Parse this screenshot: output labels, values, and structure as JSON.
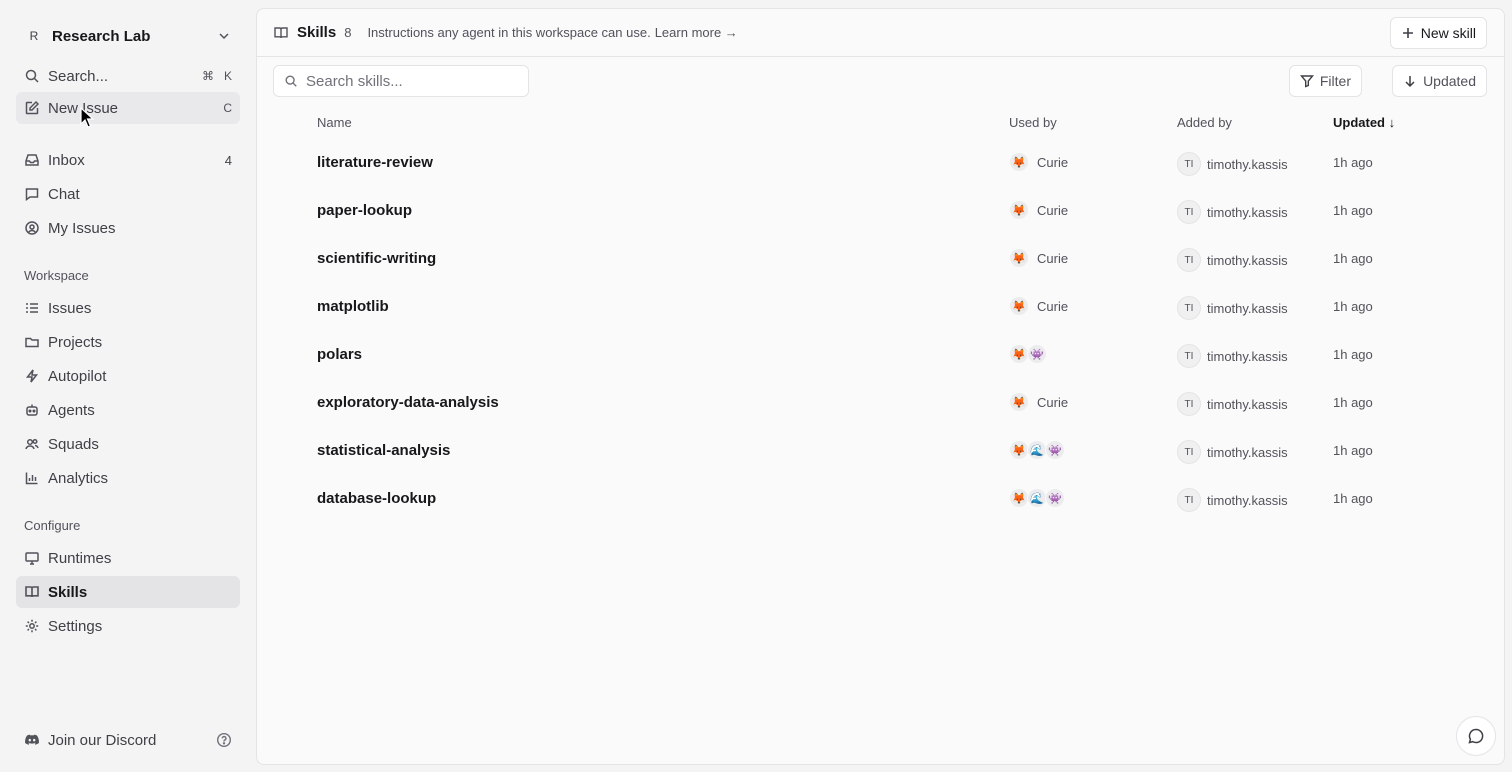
{
  "workspace": {
    "avatar": "R",
    "name": "Research Lab"
  },
  "sidebar": {
    "search": {
      "label": "Search...",
      "shortcut_cmd": "⌘",
      "shortcut_key": "K"
    },
    "new_issue": {
      "label": "New Issue",
      "shortcut": "C"
    },
    "primary": [
      {
        "label": "Inbox",
        "icon": "inbox-icon",
        "count": "4"
      },
      {
        "label": "Chat",
        "icon": "chat-icon"
      },
      {
        "label": "My Issues",
        "icon": "user-circle-icon"
      }
    ],
    "workspace_label": "Workspace",
    "workspace_items": [
      {
        "label": "Issues",
        "icon": "list-icon"
      },
      {
        "label": "Projects",
        "icon": "folder-icon"
      },
      {
        "label": "Autopilot",
        "icon": "bolt-icon"
      },
      {
        "label": "Agents",
        "icon": "bot-icon"
      },
      {
        "label": "Squads",
        "icon": "users-icon"
      },
      {
        "label": "Analytics",
        "icon": "bar-chart-icon"
      }
    ],
    "configure_label": "Configure",
    "configure_items": [
      {
        "label": "Runtimes",
        "icon": "monitor-icon"
      },
      {
        "label": "Skills",
        "icon": "book-icon",
        "active": true
      },
      {
        "label": "Settings",
        "icon": "gear-icon"
      }
    ],
    "footer": {
      "discord_label": "Join our Discord"
    }
  },
  "header": {
    "title": "Skills",
    "count": "8",
    "description": "Instructions any agent in this workspace can use.",
    "learn_more": "Learn more →",
    "new_skill_label": "New skill"
  },
  "toolbar": {
    "search_placeholder": "Search skills...",
    "filter_label": "Filter",
    "sort_label": "Updated"
  },
  "table": {
    "columns": {
      "name": "Name",
      "used_by": "Used by",
      "added_by": "Added by",
      "updated": "Updated ↓"
    },
    "rows": [
      {
        "name": "literature-review",
        "avatars": [
          "🦊"
        ],
        "used_by": "Curie",
        "added_initials": "TI",
        "added_by": "timothy.kassis",
        "updated": "1h ago"
      },
      {
        "name": "paper-lookup",
        "avatars": [
          "🦊"
        ],
        "used_by": "Curie",
        "added_initials": "TI",
        "added_by": "timothy.kassis",
        "updated": "1h ago"
      },
      {
        "name": "scientific-writing",
        "avatars": [
          "🦊"
        ],
        "used_by": "Curie",
        "added_initials": "TI",
        "added_by": "timothy.kassis",
        "updated": "1h ago"
      },
      {
        "name": "matplotlib",
        "avatars": [
          "🦊"
        ],
        "used_by": "Curie",
        "added_initials": "TI",
        "added_by": "timothy.kassis",
        "updated": "1h ago"
      },
      {
        "name": "polars",
        "avatars": [
          "🦊",
          "👾"
        ],
        "used_by": "",
        "added_initials": "TI",
        "added_by": "timothy.kassis",
        "updated": "1h ago"
      },
      {
        "name": "exploratory-data-analysis",
        "avatars": [
          "🦊"
        ],
        "used_by": "Curie",
        "added_initials": "TI",
        "added_by": "timothy.kassis",
        "updated": "1h ago"
      },
      {
        "name": "statistical-analysis",
        "avatars": [
          "🦊",
          "🌊",
          "👾"
        ],
        "used_by": "",
        "added_initials": "TI",
        "added_by": "timothy.kassis",
        "updated": "1h ago"
      },
      {
        "name": "database-lookup",
        "avatars": [
          "🦊",
          "🌊",
          "👾"
        ],
        "used_by": "",
        "added_initials": "TI",
        "added_by": "timothy.kassis",
        "updated": "1h ago"
      }
    ]
  }
}
